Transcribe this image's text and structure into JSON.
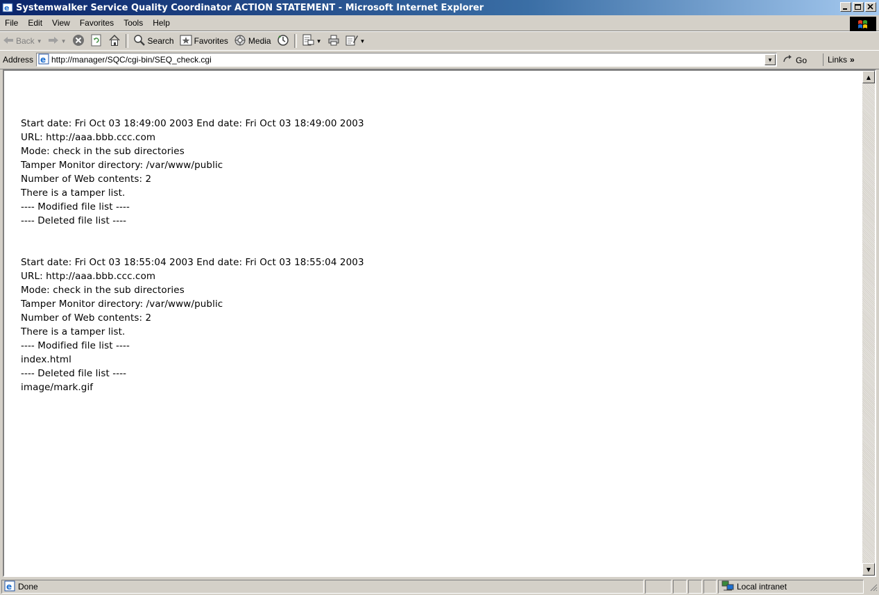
{
  "window": {
    "title": "Systemwalker Service Quality Coordinator ACTION STATEMENT - Microsoft Internet Explorer"
  },
  "menu": [
    "File",
    "Edit",
    "View",
    "Favorites",
    "Tools",
    "Help"
  ],
  "toolbar": {
    "back_label": "Back",
    "search_label": "Search",
    "favorites_label": "Favorites",
    "media_label": "Media"
  },
  "address": {
    "label": "Address",
    "url": "http://manager/SQC/cgi-bin/SEQ_check.cgi",
    "go_label": "Go",
    "links_label": "Links"
  },
  "reports": [
    {
      "lines": [
        "Start date: Fri Oct 03 18:49:00 2003 End date: Fri Oct 03 18:49:00 2003",
        "URL: http://aaa.bbb.ccc.com",
        "Mode: check in the sub directories",
        "Tamper Monitor directory: /var/www/public",
        "Number of Web contents: 2",
        "There is a tamper list.",
        "---- Modified file list ----",
        "---- Deleted file list ----"
      ]
    },
    {
      "lines": [
        "Start date: Fri Oct 03 18:55:04 2003 End date: Fri Oct 03 18:55:04 2003",
        "URL: http://aaa.bbb.ccc.com",
        "Mode: check in the sub directories",
        "Tamper Monitor directory: /var/www/public",
        "Number of Web contents: 2",
        "There is a tamper list.",
        "---- Modified file list ----",
        "index.html",
        "---- Deleted file list ----",
        "image/mark.gif"
      ]
    }
  ],
  "status": {
    "text": "Done",
    "zone": "Local intranet"
  }
}
